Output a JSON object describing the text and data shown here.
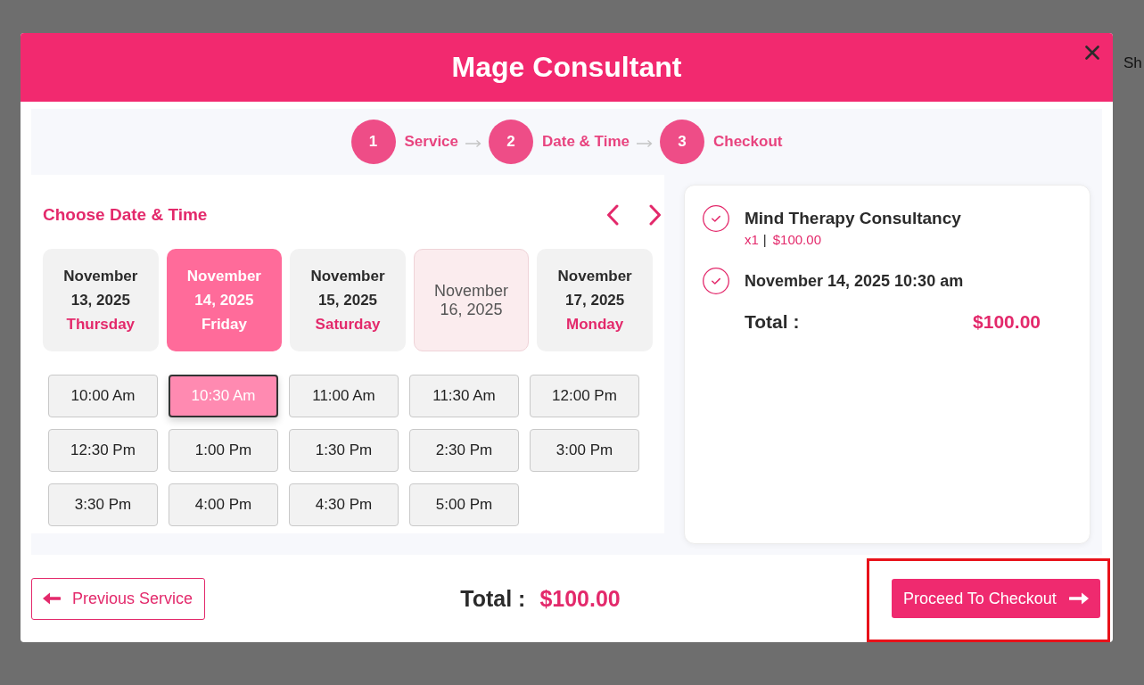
{
  "background_text": "Sh",
  "modal": {
    "title": "Mage Consultant"
  },
  "steps": [
    {
      "number": "1",
      "label": "Service"
    },
    {
      "number": "2",
      "label": "Date & Time"
    },
    {
      "number": "3",
      "label": "Checkout"
    }
  ],
  "date_picker": {
    "heading": "Choose Date & Time",
    "dates": [
      {
        "date": "November 13, 2025",
        "day": "Thursday",
        "selected": false,
        "disabled": false
      },
      {
        "date": "November 14, 2025",
        "day": "Friday",
        "selected": true,
        "disabled": false
      },
      {
        "date": "November 15, 2025",
        "day": "Saturday",
        "selected": false,
        "disabled": false
      },
      {
        "date": "November 16, 2025",
        "selected": false,
        "disabled": true
      },
      {
        "date": "November 17, 2025",
        "day": "Monday",
        "selected": false,
        "disabled": false
      }
    ],
    "time_slots": [
      {
        "label": "10:00 Am",
        "selected": false
      },
      {
        "label": "10:30 Am",
        "selected": true
      },
      {
        "label": "11:00 Am",
        "selected": false
      },
      {
        "label": "11:30 Am",
        "selected": false
      },
      {
        "label": "12:00 Pm",
        "selected": false
      },
      {
        "label": "12:30 Pm",
        "selected": false
      },
      {
        "label": "1:00 Pm",
        "selected": false
      },
      {
        "label": "1:30 Pm",
        "selected": false
      },
      {
        "label": "2:30 Pm",
        "selected": false
      },
      {
        "label": "3:00 Pm",
        "selected": false
      },
      {
        "label": "3:30 Pm",
        "selected": false
      },
      {
        "label": "4:00 Pm",
        "selected": false
      },
      {
        "label": "4:30 Pm",
        "selected": false
      },
      {
        "label": "5:00 Pm",
        "selected": false
      }
    ]
  },
  "summary": {
    "service": {
      "name": "Mind Therapy Consultancy",
      "quantity": "x1",
      "separator": "|",
      "price": "$100.00"
    },
    "booking": {
      "datetime": "November 14, 2025 10:30 am"
    },
    "total_label": "Total :",
    "total_value": "$100.00"
  },
  "footer": {
    "back_button": {
      "label": "Previous Service"
    },
    "total_label": "Total :",
    "total_value": "$100.00",
    "next_button": {
      "label": "Proceed To Checkout",
      "highlighted": true
    }
  }
}
